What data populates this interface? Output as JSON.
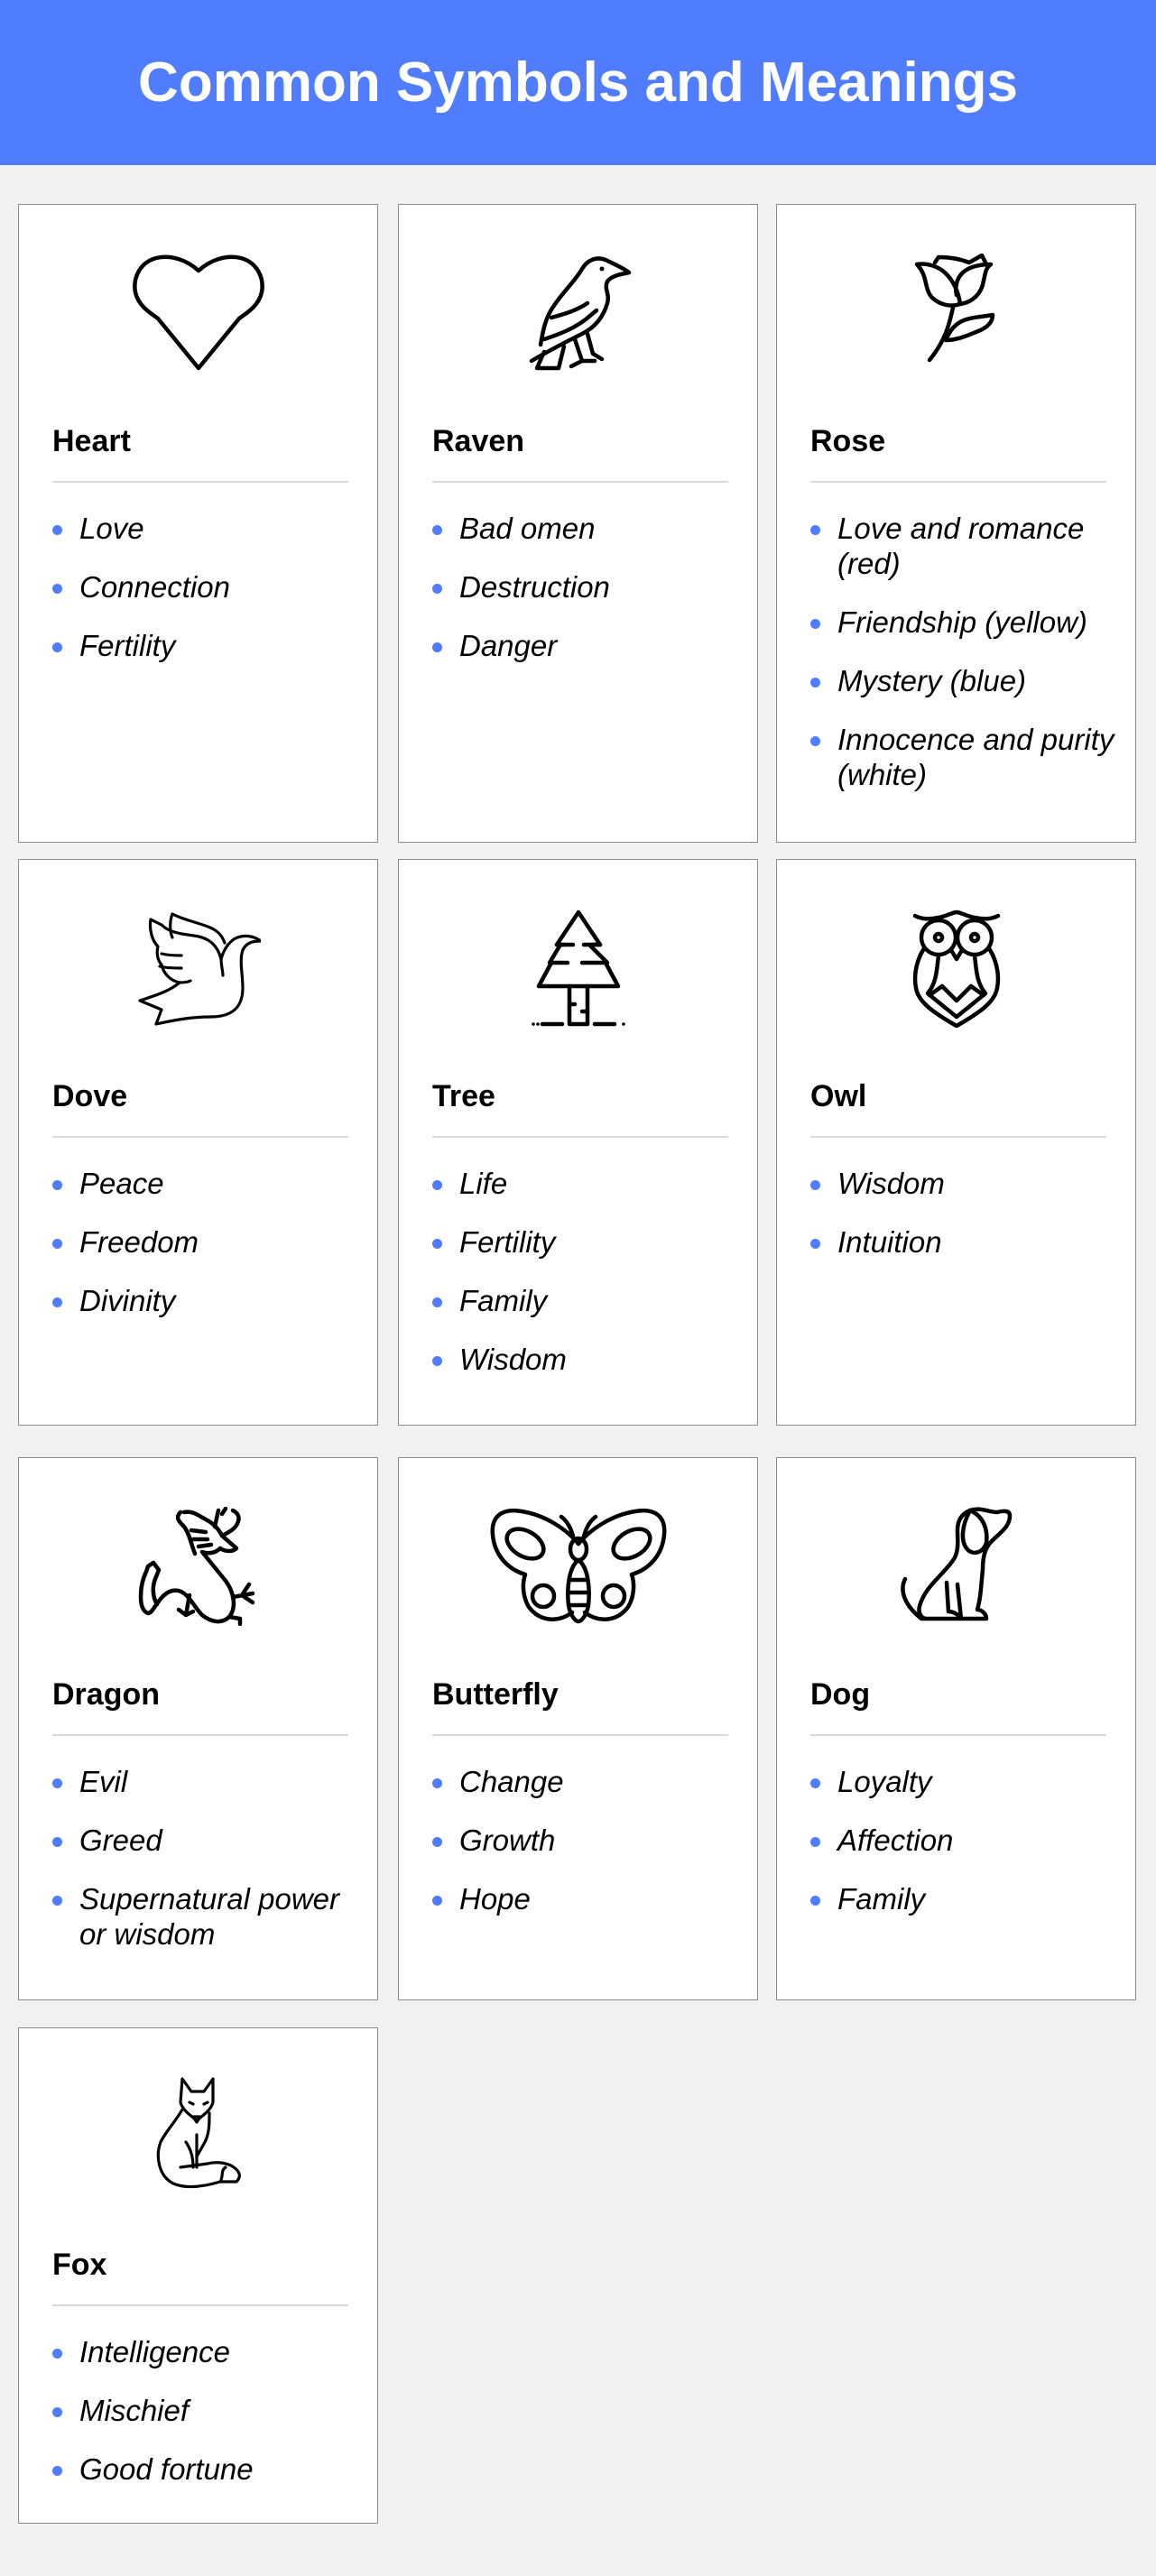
{
  "header": {
    "title": "Common Symbols and Meanings",
    "background_color": "#507dff"
  },
  "accent_color": "#507dff",
  "cards": [
    {
      "name": "Heart",
      "icon": "heart-icon",
      "meanings": [
        "Love",
        "Connection",
        "Fertility"
      ]
    },
    {
      "name": "Raven",
      "icon": "raven-icon",
      "meanings": [
        "Bad omen",
        "Destruction",
        "Danger"
      ]
    },
    {
      "name": "Rose",
      "icon": "rose-icon",
      "meanings": [
        "Love and romance (red)",
        "Friendship (yellow)",
        "Mystery (blue)",
        "Innocence and purity (white)"
      ]
    },
    {
      "name": "Dove",
      "icon": "dove-icon",
      "meanings": [
        "Peace",
        "Freedom",
        "Divinity"
      ]
    },
    {
      "name": "Tree",
      "icon": "tree-icon",
      "meanings": [
        "Life",
        "Fertility",
        "Family",
        "Wisdom"
      ]
    },
    {
      "name": "Owl",
      "icon": "owl-icon",
      "meanings": [
        "Wisdom",
        "Intuition"
      ]
    },
    {
      "name": "Dragon",
      "icon": "dragon-icon",
      "meanings": [
        "Evil",
        "Greed",
        "Supernatural power or wisdom"
      ]
    },
    {
      "name": "Butterfly",
      "icon": "butterfly-icon",
      "meanings": [
        "Change",
        "Growth",
        "Hope"
      ]
    },
    {
      "name": "Dog",
      "icon": "dog-icon",
      "meanings": [
        "Loyalty",
        "Affection",
        "Family"
      ]
    },
    {
      "name": "Fox",
      "icon": "fox-icon",
      "meanings": [
        "Intelligence",
        "Mischief",
        "Good fortune"
      ]
    }
  ]
}
